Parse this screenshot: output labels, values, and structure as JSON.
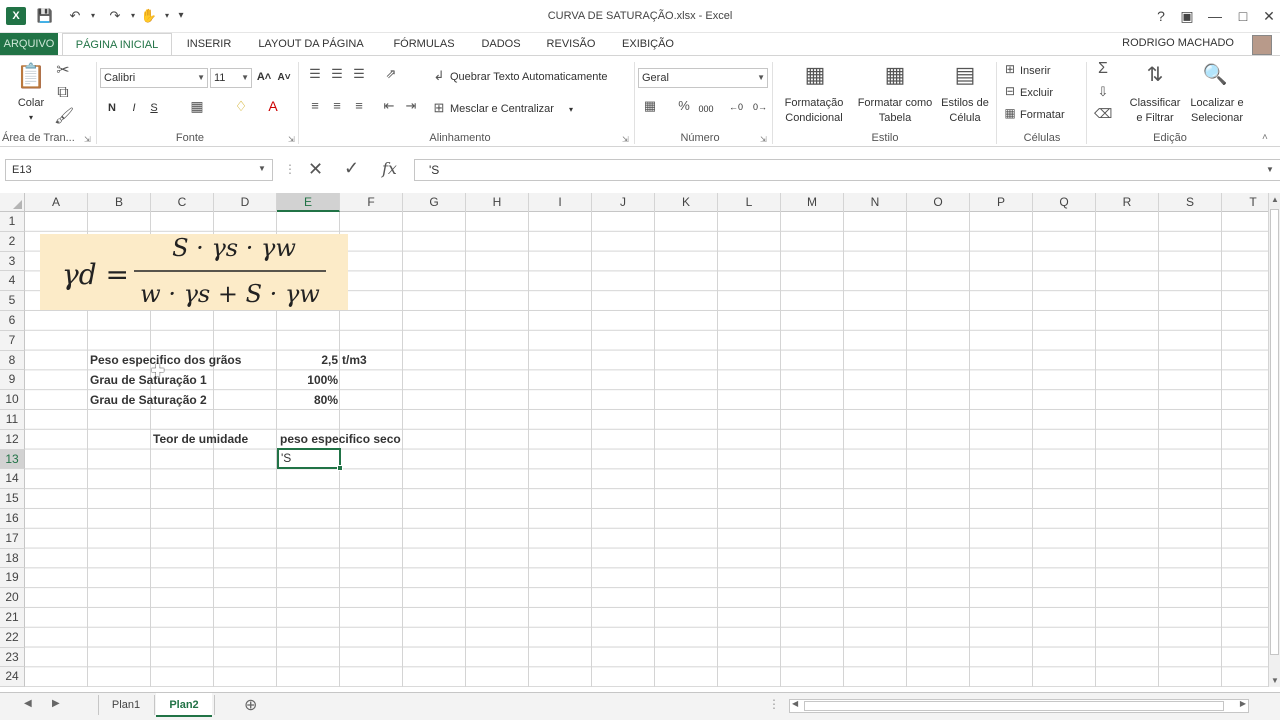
{
  "window": {
    "title": "CURVA DE SATURAÇÃO.xlsx - Excel",
    "user": "RODRIGO MACHADO"
  },
  "tabs": [
    "ARQUIVO",
    "PÁGINA INICIAL",
    "INSERIR",
    "LAYOUT DA PÁGINA",
    "FÓRMULAS",
    "DADOS",
    "REVISÃO",
    "EXIBIÇÃO"
  ],
  "active_tab": "PÁGINA INICIAL",
  "ribbon": {
    "clipboard": {
      "paste": "Colar",
      "group": "Área de Tran..."
    },
    "font": {
      "name": "Calibri",
      "size": "11",
      "bold": "N",
      "italic": "I",
      "underline": "S",
      "group": "Fonte"
    },
    "alignment": {
      "wrap": "Quebrar Texto Automaticamente",
      "merge": "Mesclar e Centralizar",
      "group": "Alinhamento"
    },
    "number": {
      "format": "Geral",
      "group": "Número"
    },
    "styles": {
      "cond_1": "Formatação",
      "cond_2": "Condicional",
      "table_1": "Formatar como",
      "table_2": "Tabela",
      "cell_1": "Estilos de",
      "cell_2": "Célula",
      "group": "Estilo"
    },
    "cells": {
      "insert": "Inserir",
      "delete": "Excluir",
      "format": "Formatar",
      "group": "Células"
    },
    "editing": {
      "sort_1": "Classificar",
      "sort_2": "e Filtrar",
      "find_1": "Localizar e",
      "find_2": "Selecionar",
      "group": "Edição"
    }
  },
  "formula_bar": {
    "name_box": "E13",
    "content": "'S"
  },
  "columns": [
    "A",
    "B",
    "C",
    "D",
    "E",
    "F",
    "G",
    "H",
    "I",
    "J",
    "K",
    "L",
    "M",
    "N",
    "O",
    "P",
    "Q",
    "R",
    "S",
    "T"
  ],
  "rows": [
    "1",
    "2",
    "3",
    "4",
    "5",
    "6",
    "7",
    "8",
    "9",
    "10",
    "11",
    "12",
    "13",
    "14",
    "15",
    "16",
    "17",
    "18",
    "19",
    "20",
    "21",
    "22",
    "23",
    "24"
  ],
  "selected_cell": {
    "col": "E",
    "row": "13"
  },
  "cells": {
    "B8": "Peso especifico dos grãos",
    "E8": "2,5",
    "F8": "t/m3",
    "B9": "Grau de Saturação 1",
    "E9": "100%",
    "B10": "Grau de Saturação 2",
    "E10": "80%",
    "C12": "Teor de umidade",
    "E12": "peso especifico seco",
    "E13": "'S"
  },
  "formula_image": {
    "lhs": "γd =",
    "numerator": "S · γs · γw",
    "denominator": "w · γs + S · γw"
  },
  "sheets": [
    "Plan1",
    "Plan2"
  ],
  "active_sheet": "Plan2",
  "colors": {
    "accent": "#217346",
    "formula_bg": "#fcebc8"
  }
}
